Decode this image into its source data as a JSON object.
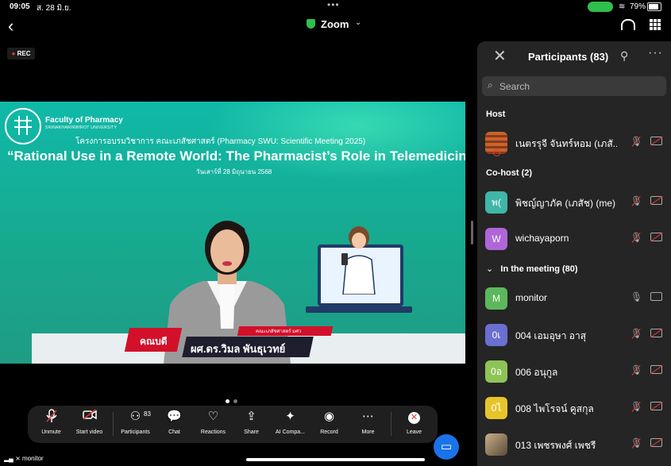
{
  "status": {
    "time": "09:05",
    "date": "ส. 28 มิ.ย.",
    "battery": "79%"
  },
  "window": {
    "title": "Zoom"
  },
  "rec_label": "REC",
  "slide": {
    "faculty": "Faculty of Pharmacy",
    "university": "SRINAKHARINWIROT UNIVERSITY",
    "project": "โครงการอบรมวิชาการ คณะเภสัชศาสตร์ (Pharmacy SWU: Scientific Meeting 2025)",
    "headline": "“Rational Use in a Remote World: The Pharmacist’s Role in Telemedicine”",
    "date": "วันเสาร์ที่ 28 มิถุนายน 2568",
    "banner_role": "คณบดี",
    "banner_name": "ผศ.ดร.วิมล พันธุเวทย์",
    "banner_small": "คณะเภสัชศาสตร์ มศว"
  },
  "toolbar": {
    "participants_count": "83",
    "items": [
      {
        "label": "Unmute",
        "icon": "mic-muted-icon"
      },
      {
        "label": "Start video",
        "icon": "video-off-icon"
      },
      {
        "label": "Participants",
        "icon": "participants-icon"
      },
      {
        "label": "Chat",
        "icon": "chat-icon"
      },
      {
        "label": "Reactions",
        "icon": "heart-icon"
      },
      {
        "label": "Share",
        "icon": "share-icon"
      },
      {
        "label": "AI Compa...",
        "icon": "sparkle-icon"
      },
      {
        "label": "Record",
        "icon": "record-icon"
      },
      {
        "label": "More",
        "icon": "more-icon"
      },
      {
        "label": "Leave",
        "icon": "leave-icon"
      }
    ]
  },
  "self_label": "monitor",
  "panel": {
    "title": "Participants (83)",
    "search_placeholder": "Search",
    "host_header": "Host",
    "cohost_header": "Co-host (2)",
    "meeting_header": "In the meeting (80)",
    "host": {
      "name": "เนตรรุจี จันทร์หอม (เภสั...",
      "avatar_color": "#b5552a"
    },
    "cohosts": [
      {
        "initials": "พ(",
        "name": "พิชญ์ญาภัค (เภสัช) (me)",
        "color": "#3fb6a8"
      },
      {
        "initials": "W",
        "name": "wichayaporn",
        "color": "#b066d9"
      }
    ],
    "members": [
      {
        "initials": "M",
        "name": "monitor",
        "color": "#5cb85c",
        "mic_muted": false
      },
      {
        "initials": "0เ",
        "name": "004 เอมอุษา อาสุ",
        "color": "#6a6fd1",
        "mic_muted": true
      },
      {
        "initials": "0อ",
        "name": "006 อนุกูล",
        "color": "#8ec456",
        "mic_muted": true
      },
      {
        "initials": "0ไ",
        "name": "008 ไพโรจน์ คูสกุล",
        "color": "#e6c52a",
        "mic_muted": true
      },
      {
        "initials": "",
        "name": "013 เพชรพงศ์ เพชรี",
        "color": "#8a7a60",
        "mic_muted": true
      }
    ]
  },
  "colors": {
    "slide_bg": "#10b9a8",
    "accent_red": "#d3102a",
    "zoom_blue": "#1a73e8",
    "panel_bg": "#252525"
  }
}
